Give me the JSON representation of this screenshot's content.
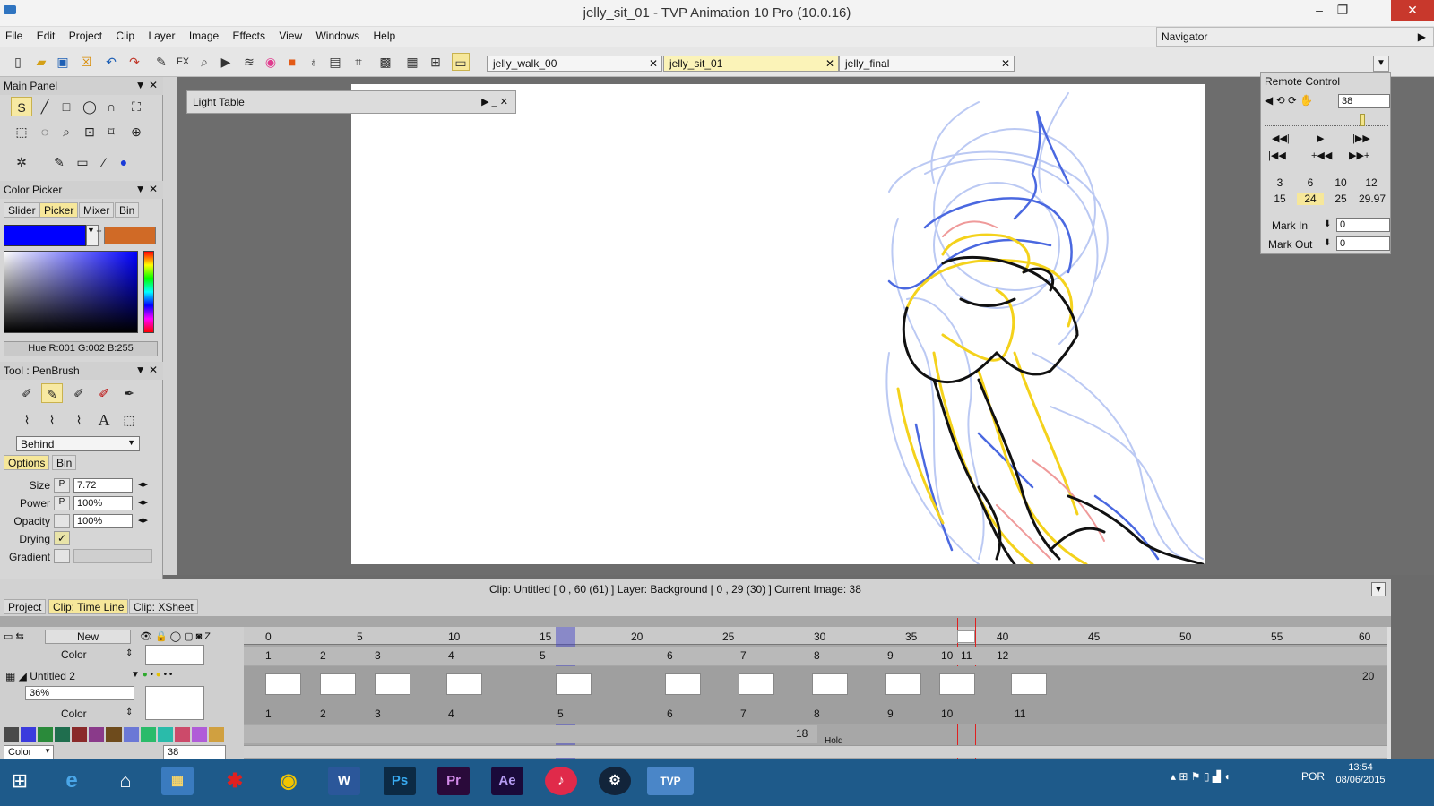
{
  "window": {
    "title": "jelly_sit_01 - TVP Animation 10 Pro (10.0.16)",
    "minimize": "–",
    "maximize": "❐",
    "close": "✕"
  },
  "menu": [
    "File",
    "Edit",
    "Project",
    "Clip",
    "Layer",
    "Image",
    "Effects",
    "View",
    "Windows",
    "Help"
  ],
  "navigator": {
    "label": "Navigator",
    "arrow": "▶"
  },
  "project_tabs": [
    {
      "label": "jelly_walk_00",
      "close": "✕"
    },
    {
      "label": "jelly_sit_01",
      "close": "✕"
    },
    {
      "label": "jelly_final",
      "close": "✕"
    }
  ],
  "main_panel": {
    "title": "Main Panel"
  },
  "color_picker": {
    "title": "Color Picker",
    "tabs": [
      "Slider",
      "Picker",
      "Mixer",
      "Bin"
    ],
    "main_color": "#0000ff",
    "secondary_color": "#d06a26",
    "info": "Hue R:001 G:002 B:255"
  },
  "tool": {
    "title": "Tool : PenBrush",
    "mode": "Behind",
    "tabs": [
      "Options",
      "Bin"
    ],
    "fields": [
      {
        "label": "Size",
        "value": "7.72"
      },
      {
        "label": "Power",
        "value": "100%"
      },
      {
        "label": "Opacity",
        "value": "100%"
      },
      {
        "label": "Drying",
        "value": "✓"
      },
      {
        "label": "Gradient",
        "value": ""
      }
    ],
    "p_marker": "P"
  },
  "light_table": {
    "title": "Light Table"
  },
  "remote_control": {
    "title": "Remote Control",
    "frame": "38",
    "fps_row1": [
      "3",
      "6",
      "10",
      "12"
    ],
    "fps_row2": [
      "15",
      "24",
      "25",
      "29.97"
    ],
    "mark_in_label": "Mark In",
    "mark_in_value": "0",
    "mark_out_label": "Mark Out",
    "mark_out_value": "0"
  },
  "clip_status": "Clip: Untitled [ 0 , 60  (61) ]     Layer: Background [ 0 , 29  (30) ]    Current Image: 38",
  "bottom_tabs": [
    "Project",
    "Clip: Time Line",
    "Clip: XSheet"
  ],
  "timeline": {
    "new_label": "New",
    "ruler": [
      "0",
      "5",
      "10",
      "15",
      "20",
      "25",
      "30",
      "35",
      "40",
      "45",
      "50",
      "55",
      "60"
    ],
    "color_label": "Color",
    "layer_name": "Untitled 2",
    "layer_opacity": "36%",
    "layer_color_label": "Color",
    "frame_numbers_top": [
      "1",
      "2",
      "3",
      "4",
      "5",
      "6",
      "7",
      "8",
      "9",
      "10",
      "11",
      "12"
    ],
    "frame_numbers_bottom": [
      "1",
      "2",
      "3",
      "4",
      "5",
      "6",
      "7",
      "8",
      "9",
      "10",
      "11"
    ],
    "end_count": "20",
    "bottom_count": "18",
    "hold_label": "Hold",
    "footer_label": "Color",
    "footer_value": "38"
  },
  "taskbar": {
    "apps": [
      "e",
      "⌂",
      "▦",
      "✱",
      "◉",
      "W",
      "Ps",
      "Pr",
      "Ae",
      "♪",
      "⚙",
      "TVP"
    ],
    "lang": "POR",
    "time": "13:54",
    "date": "08/06/2015"
  }
}
